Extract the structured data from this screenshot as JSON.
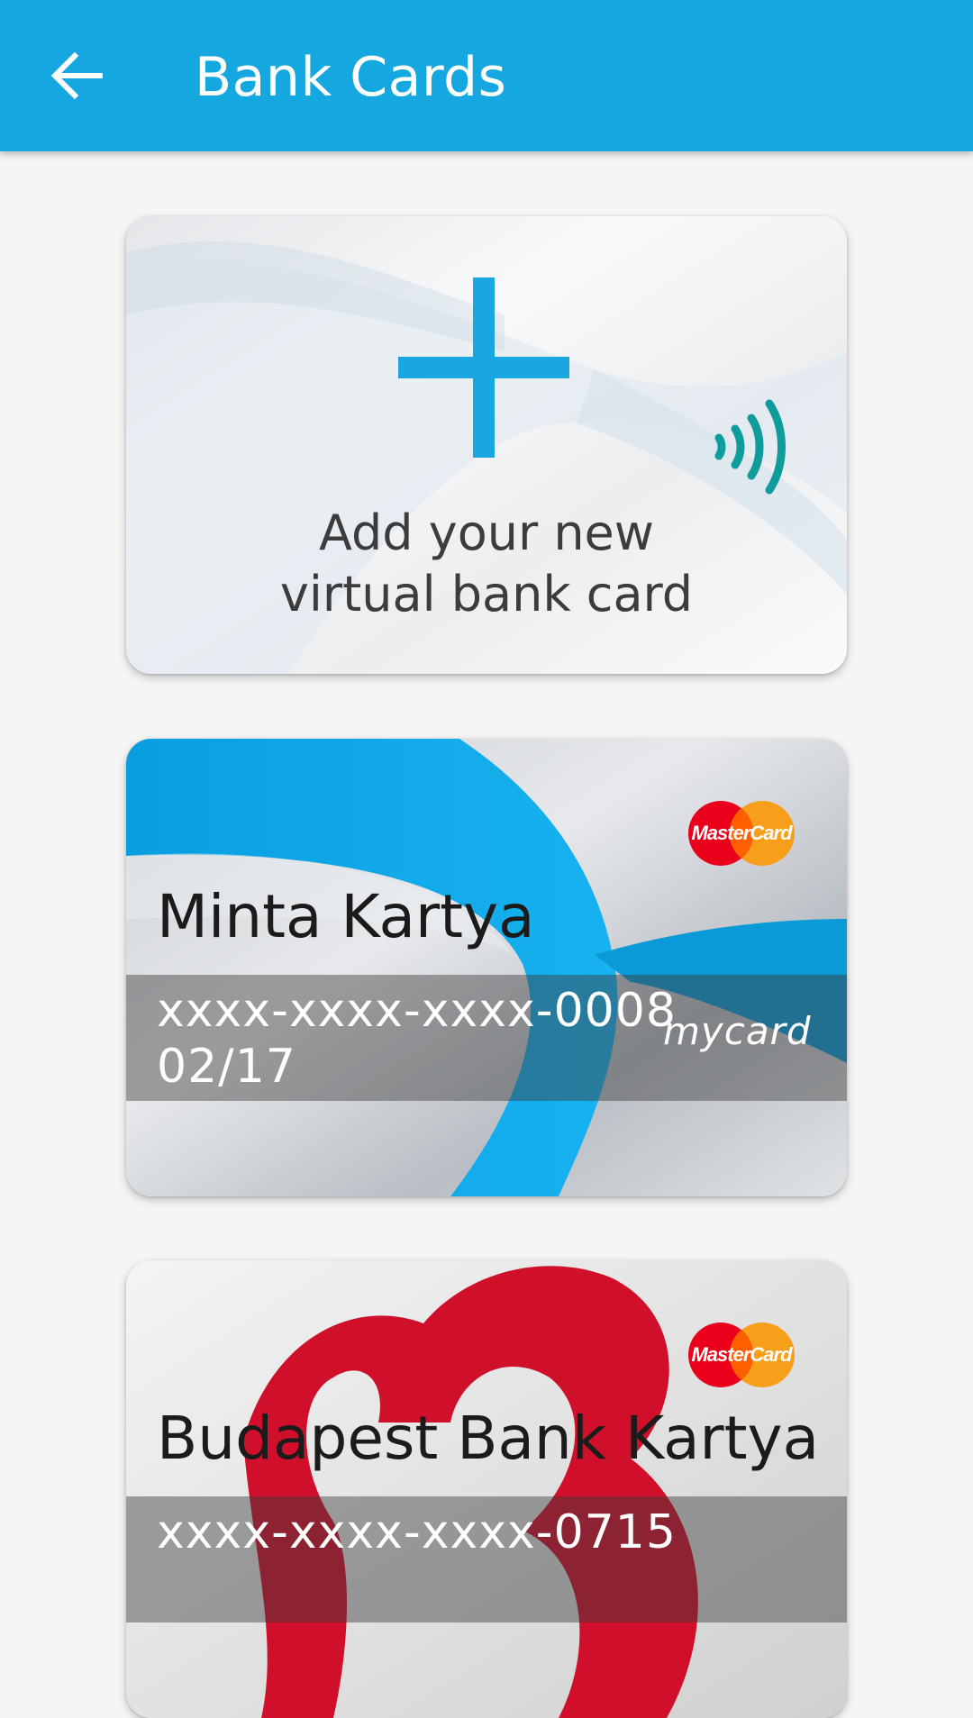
{
  "colors": {
    "app_bar": "#15a8e0",
    "accent_blue": "#1aa7e1",
    "nfc_teal": "#109c9c",
    "bank_red": "#d0102a",
    "mastercard_red": "#eb001b",
    "mastercard_orange": "#f79e1b"
  },
  "app_bar": {
    "back_icon": "arrow-left-icon",
    "title": "Bank Cards"
  },
  "add_card": {
    "icon": "plus-icon",
    "nfc_icon": "contactless-icon",
    "line1": "Add your new",
    "line2": "virtual bank card"
  },
  "cards": [
    {
      "name": "Minta Kartya",
      "number": "xxxx-xxxx-xxxx-0008",
      "expiry": "02/17",
      "network": "MasterCard",
      "brand": "mycard"
    },
    {
      "name": "Budapest Bank Kartya",
      "number": "xxxx-xxxx-xxxx-0715",
      "network": "MasterCard"
    }
  ]
}
